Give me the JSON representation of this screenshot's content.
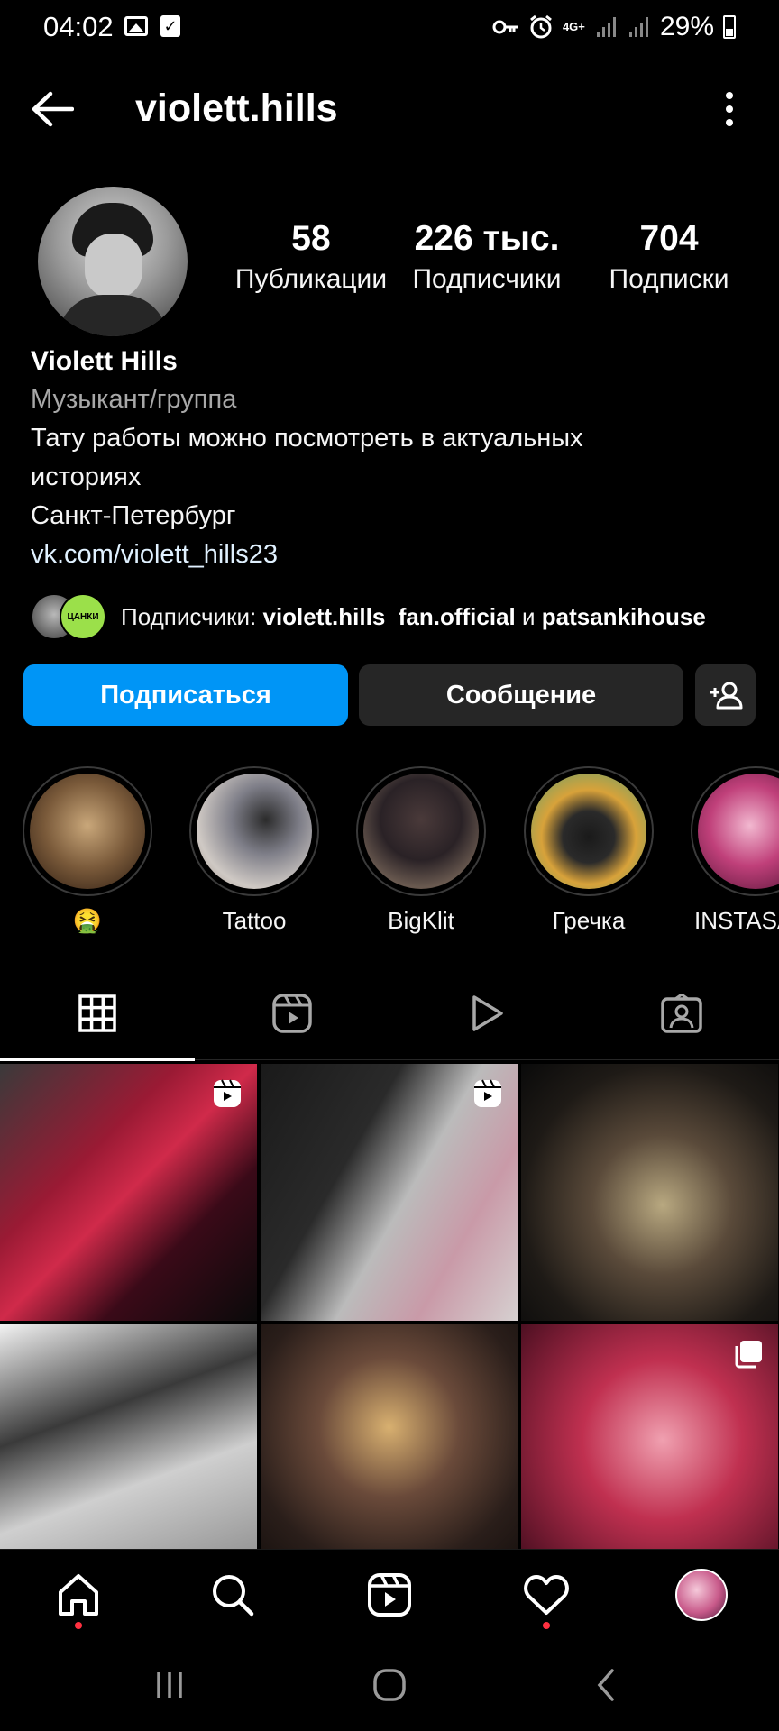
{
  "status_bar": {
    "time": "04:02",
    "battery": "29%",
    "network": "4G+",
    "icons": [
      "image-icon",
      "check-icon",
      "key-icon",
      "alarm-icon",
      "network-icon",
      "signal-icon",
      "signal-icon",
      "battery-icon"
    ]
  },
  "header": {
    "username": "violett.hills",
    "icons": [
      "back-arrow-icon",
      "more-vertical-icon"
    ]
  },
  "profile": {
    "stats": [
      {
        "value": "58",
        "label": "Публикации"
      },
      {
        "value": "226 тыс.",
        "label": "Подписчики"
      },
      {
        "value": "704",
        "label": "Подписки"
      }
    ],
    "name": "Violett Hills",
    "category": "Музыкант/группа",
    "bio_line1": "Тату работы можно посмотреть в актуальных",
    "bio_line2": "историях",
    "location": "Санкт-Петербург",
    "link": "vk.com/violett_hills23",
    "followed_by": {
      "prefix": "Подписчики:",
      "user1": "violett.hills_fan.official",
      "joiner": "и",
      "user2": "patsankihouse",
      "avatar2_text": "ЦАНКИ"
    }
  },
  "actions": {
    "follow": "Подписаться",
    "message": "Сообщение"
  },
  "highlights": [
    {
      "label": "🤮"
    },
    {
      "label": "Tattoo"
    },
    {
      "label": "BigKlit"
    },
    {
      "label": "Гречка"
    },
    {
      "label": "INSTASA"
    }
  ],
  "tabs": [
    "grid-icon",
    "reels-icon",
    "play-icon",
    "tagged-icon"
  ],
  "bottom_nav": [
    "home-icon",
    "search-icon",
    "reels-icon",
    "heart-icon",
    "profile-avatar"
  ],
  "colors": {
    "accent": "#0095f6",
    "secondary_button": "#262626",
    "background": "#000000",
    "notification_dot": "#ff3040"
  }
}
